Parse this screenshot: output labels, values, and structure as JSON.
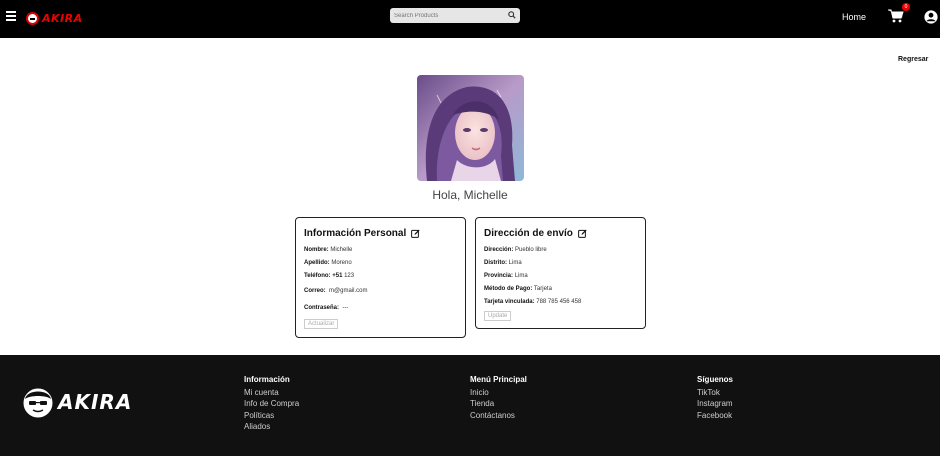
{
  "header": {
    "logo_text": "AKIRA",
    "search_placeholder": "Search Products",
    "nav_home": "Home",
    "cart_count": "0"
  },
  "back_link": "Regresar",
  "greeting": "Hola, Michelle",
  "personal": {
    "title": "Información Personal",
    "nombre_label": "Nombre:",
    "nombre": "Michelle",
    "apellido_label": "Apellido:",
    "apellido": "Moreno",
    "telefono_label": "Teléfono:",
    "telefono_prefix": "+51",
    "telefono": "123",
    "correo_label": "Correo:",
    "correo": "m@gmail.com",
    "contrasena_label": "Contraseña:",
    "contrasena": "---",
    "button": "Actualizar"
  },
  "envio": {
    "title": "Dirección de envío",
    "direccion_label": "Dirección:",
    "direccion": "Pueblo libre",
    "distrito_label": "Distrito:",
    "distrito": "Lima",
    "provincia_label": "Provincia:",
    "provincia": "Lima",
    "metodo_label": "Método de Pago:",
    "metodo": "Tarjeta",
    "tarjeta_label": "Tarjeta vinculada:",
    "tarjeta": "788 785 456 458",
    "button": "Update"
  },
  "footer": {
    "logo_text": "AKIRA",
    "info": {
      "title": "Información",
      "links": [
        "Mi cuenta",
        "Info de Compra",
        "Políticas",
        "Aliados"
      ]
    },
    "menu": {
      "title": "Menú Principal",
      "links": [
        "Inicio",
        "Tienda",
        "Contáctanos"
      ]
    },
    "social": {
      "title": "Síguenos",
      "links": [
        "TikTok",
        "Instagram",
        "Facebook"
      ]
    }
  },
  "colors": {
    "accent": "#e00000",
    "header_bg": "#000000",
    "footer_bg": "#111111"
  }
}
